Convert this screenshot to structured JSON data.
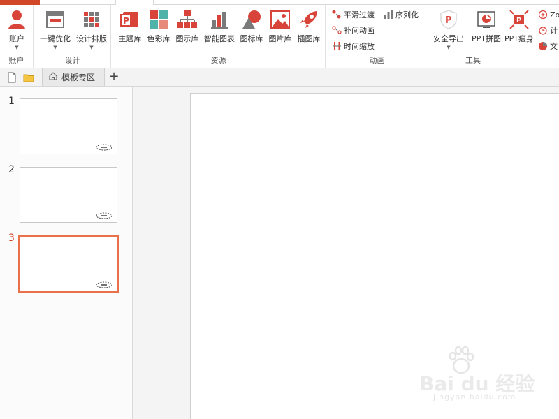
{
  "ribbon": {
    "groups": {
      "account": {
        "label": "账户",
        "account_button": "账户"
      },
      "design": {
        "label": "设计",
        "one_click_optimize": "一键优化",
        "design_layout": "设计排版"
      },
      "resources": {
        "label": "资源",
        "theme_library": "主题库",
        "color_library": "色彩库",
        "diagram_library": "图示库",
        "smart_chart": "智能图表",
        "icon_library": "图标库",
        "image_library": "图片库",
        "illustration_library": "插图库"
      },
      "animation": {
        "label": "动画",
        "smooth_transition": "平滑过渡",
        "serialize": "序列化",
        "tween_animation": "补间动画",
        "time_scale": "时间缩放"
      },
      "tools": {
        "label": "工具",
        "safe_export": "安全导出",
        "ppt_collage": "PPT拼图",
        "ppt_slim": "PPT瘦身",
        "zoom_partial": "Zo",
        "timer_partial": "计",
        "text_partial": "文"
      }
    }
  },
  "tabstrip": {
    "template_tab": "模板专区",
    "add_tab": "+"
  },
  "slides": {
    "items": [
      {
        "number": "1",
        "active": false
      },
      {
        "number": "2",
        "active": false
      },
      {
        "number": "3",
        "active": true
      }
    ]
  },
  "watermark": {
    "brand": "Bai du 经验",
    "url": "jingyan.baidu.com"
  },
  "colors": {
    "accent": "#d24726",
    "active_thumb_border": "#e8704a",
    "icon_red": "#d9443a",
    "icon_teal": "#4fb3a9",
    "icon_gray": "#7a7a7a"
  }
}
